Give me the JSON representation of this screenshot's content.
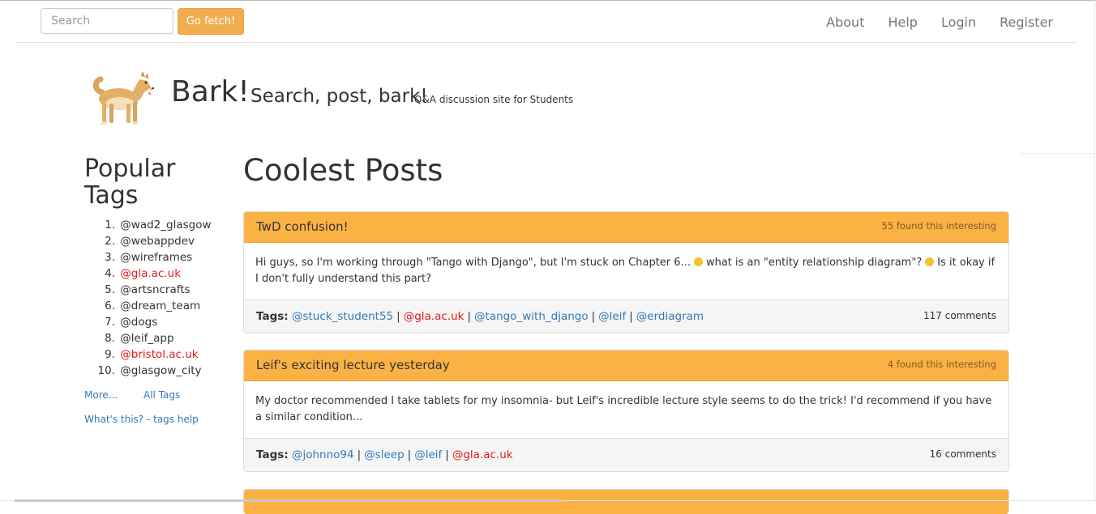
{
  "navbar": {
    "search_placeholder": "Search",
    "fetch_label": "Go fetch!",
    "links": [
      "About",
      "Help",
      "Login",
      "Register"
    ]
  },
  "header": {
    "logo_icon": "dog-icon",
    "title": "Bark!",
    "slogan": "Search, post, bark!",
    "tagline": "Q&A discussion site for Students"
  },
  "sidebar": {
    "heading": "Popular Tags",
    "tags": [
      {
        "num": "1.",
        "label": "@wad2_glasgow",
        "uni": false
      },
      {
        "num": "2.",
        "label": "@webappdev",
        "uni": false
      },
      {
        "num": "3.",
        "label": "@wireframes",
        "uni": false
      },
      {
        "num": "4.",
        "label": "@gla.ac.uk",
        "uni": true
      },
      {
        "num": "5.",
        "label": "@artsncrafts",
        "uni": false
      },
      {
        "num": "6.",
        "label": "@dream_team",
        "uni": false
      },
      {
        "num": "7.",
        "label": "@dogs",
        "uni": false
      },
      {
        "num": "8.",
        "label": "@leif_app",
        "uni": false
      },
      {
        "num": "9.",
        "label": "@bristol.ac.uk",
        "uni": true
      },
      {
        "num": "10.",
        "label": "@glasgow_city",
        "uni": false
      }
    ],
    "more_label": "More...",
    "all_tags_label": "All Tags",
    "help_label": "What's this? - tags help"
  },
  "main": {
    "heading": "Coolest Posts",
    "posts": [
      {
        "title": "TwD confusion!",
        "interest": "55 found this interesting",
        "body_1": "Hi guys, so I'm working through \"Tango with Django\", but I'm stuck on Chapter 6...",
        "body_2": "what is an \"entity relationship diagram\"?",
        "body_3": "Is it okay if I don't fully understand this part?",
        "tags_label": "Tags:",
        "tags": [
          {
            "label": "@stuck_student55",
            "uni": false
          },
          {
            "label": "@gla.ac.uk",
            "uni": true
          },
          {
            "label": "@tango_with_django",
            "uni": false
          },
          {
            "label": "@leif",
            "uni": false
          },
          {
            "label": "@erdiagram",
            "uni": false
          }
        ],
        "comments": "117 comments"
      },
      {
        "title": "Leif's exciting lecture yesterday",
        "interest": "4 found this interesting",
        "body_1": "My doctor recommended I take tablets for my insomnia- but Leif's incredible lecture style seems to do the trick! I'd recommend if you have a similar condition...",
        "tags_label": "Tags:",
        "tags": [
          {
            "label": "@johnno94",
            "uni": false
          },
          {
            "label": "@sleep",
            "uni": false
          },
          {
            "label": "@leif",
            "uni": false
          },
          {
            "label": "@gla.ac.uk",
            "uni": true
          }
        ],
        "comments": "16 comments"
      }
    ]
  },
  "colors": {
    "accent": "#f0ad4e",
    "panel_heading": "#fbb244",
    "link": "#337ab7",
    "uni_tag": "#e01b1b"
  }
}
